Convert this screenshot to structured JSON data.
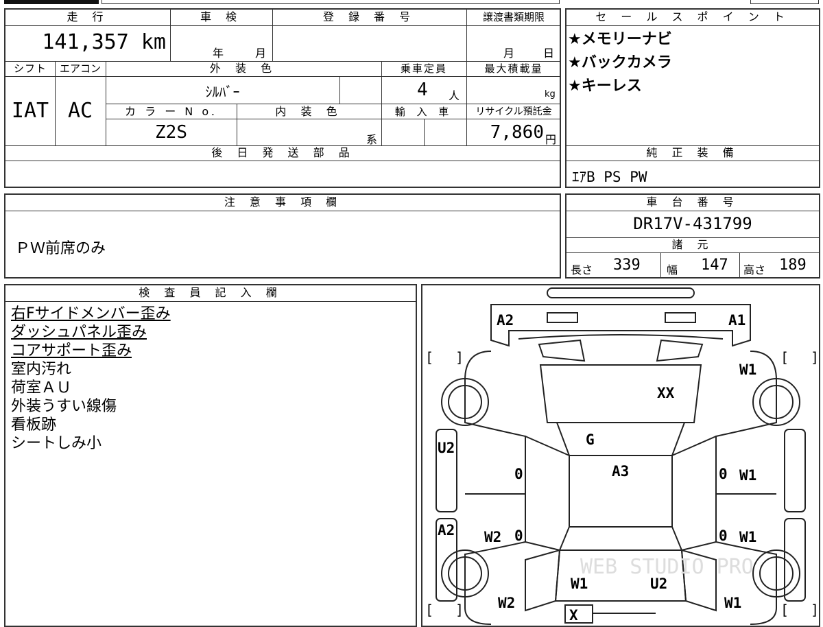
{
  "top_row": {
    "mileage_label": "走 行",
    "mileage_value": "141,357 km",
    "inspection_label": "車 検",
    "inspection_year": "年",
    "inspection_month": "月",
    "registration_label": "登 録 番 号",
    "transfer_label": "譲渡書類期限",
    "transfer_month": "月",
    "transfer_day": "日"
  },
  "row2": {
    "shift_label": "シフト",
    "ac_label": "エアコン",
    "exterior_color_label": "外 装 色",
    "capacity_label": "乗車定員",
    "max_load_label": "最大積載量",
    "shift_value": "IAT",
    "ac_value": "AC",
    "exterior_color_value": "ｼﾙﾊﾞｰ",
    "capacity_value": "4",
    "capacity_unit": "人",
    "max_load_unit": "kg",
    "color_no_label": "カ ラ ー N o.",
    "interior_color_label": "内 装 色",
    "import_label": "輸 入 車",
    "recycle_label": "リサイクル預託金",
    "color_no_value": "Z2S",
    "interior_suffix": "系",
    "recycle_value": "7,860",
    "recycle_unit": "円"
  },
  "later_parts": {
    "label": "後 日 発 送 部 品",
    "value": ""
  },
  "sales_points": {
    "label": "セ ー ル ス ポ イ ン ト",
    "items": [
      "★メモリーナビ",
      "★バックカメラ",
      "★キーレス"
    ]
  },
  "genuine_equipment": {
    "label": "純 正 装 備",
    "value": "ｴｱB PS PW"
  },
  "notes": {
    "label": "注 意 事 項 欄",
    "value": "ＰＷ前席のみ"
  },
  "chassis": {
    "label": "車 台 番 号",
    "value": "DR17V-431799"
  },
  "specs": {
    "label": "諸 元",
    "length_label": "長さ",
    "length_value": "339",
    "width_label": "幅",
    "width_value": "147",
    "height_label": "高さ",
    "height_value": "189"
  },
  "inspector": {
    "label": "検 査 員 記 入 欄",
    "lines": [
      "右Fサイドメンバー歪み",
      "ダッシュパネル歪み",
      "コアサポート歪み",
      "室内汚れ",
      "荷室ＡＵ",
      "外装うすい線傷",
      "看板跡",
      "シートしみ小"
    ]
  },
  "diagram": {
    "marks": {
      "a2_front": "A2",
      "a1_front": "A1",
      "w1_fr": "W1",
      "xx_hood": "XX",
      "g_glass": "G",
      "u2_left": "U2",
      "zero_l1": "0",
      "a3_roof": "A3",
      "zero_r1": "0",
      "w1_r1": "W1",
      "a2_left": "A2",
      "w2_l": "W2",
      "zero_l2": "0",
      "zero_r2": "0",
      "w1_r2": "W1",
      "w1_rear_l": "W1",
      "u2_rear": "U2",
      "w2_rear_l": "W2",
      "w1_rear_r": "W1",
      "x_rear": "X"
    },
    "bracket_left": "[",
    "bracket_right": "]",
    "watermark": "WEB STUDIO PRO"
  }
}
